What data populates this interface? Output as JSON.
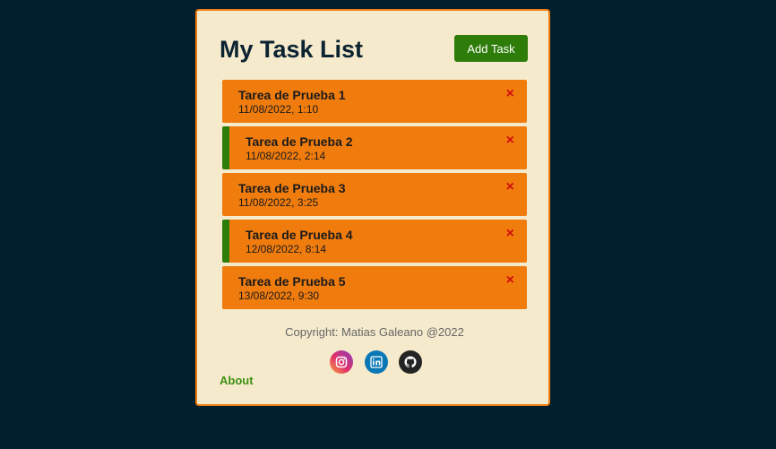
{
  "header": {
    "title": "My Task List",
    "add_button_label": "Add Task"
  },
  "tasks": [
    {
      "title": "Tarea de Prueba 1",
      "date": "11/08/2022, 1:10",
      "reminder": false,
      "delete_icon": "×"
    },
    {
      "title": "Tarea de Prueba 2",
      "date": "11/08/2022, 2:14",
      "reminder": true,
      "delete_icon": "×"
    },
    {
      "title": "Tarea de Prueba 3",
      "date": "11/08/2022, 3:25",
      "reminder": false,
      "delete_icon": "×"
    },
    {
      "title": "Tarea de Prueba 4",
      "date": "12/08/2022, 8:14",
      "reminder": true,
      "delete_icon": "×"
    },
    {
      "title": "Tarea de Prueba 5",
      "date": "13/08/2022, 9:30",
      "reminder": false,
      "delete_icon": "×"
    }
  ],
  "footer": {
    "copyright": "Copyright: Matias Galeano @2022",
    "about_link": "About",
    "social_icons": [
      "instagram-icon",
      "linkedin-icon",
      "github-icon"
    ]
  },
  "colors": {
    "background": "#011f2c",
    "card": "#f6eacd",
    "accent": "#f07c0e",
    "button": "#2e7d0b",
    "reminder_border": "#2e7d0b",
    "delete": "#d10d0d",
    "link": "#3c8f10"
  }
}
